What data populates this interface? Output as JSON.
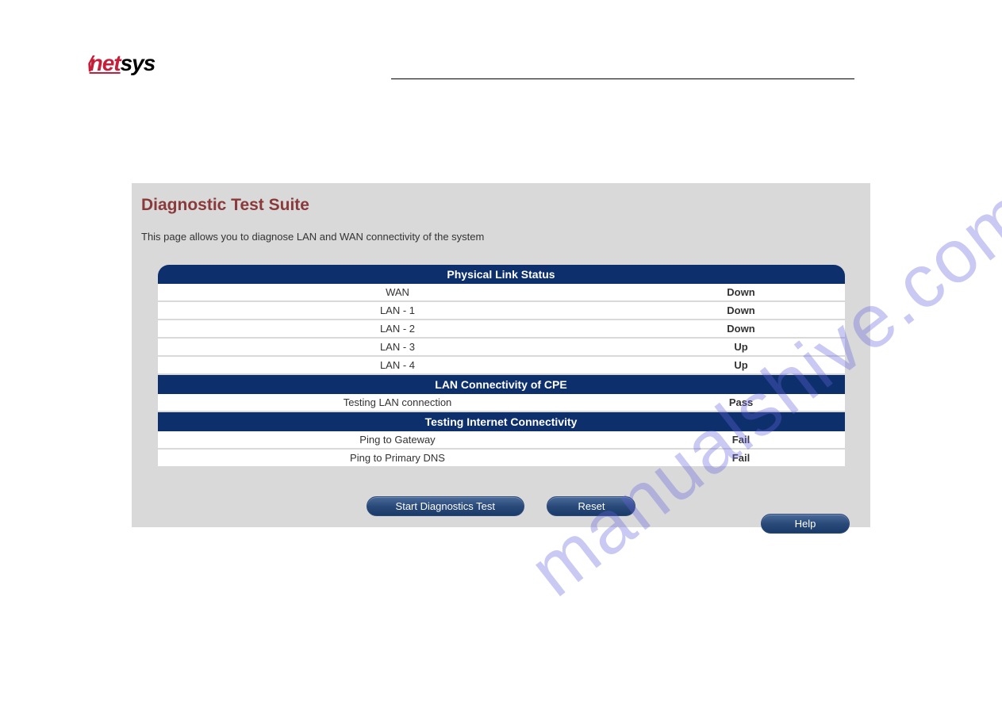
{
  "logo": {
    "prefix": "net",
    "suffix": "sys"
  },
  "watermark": "manualshive.com",
  "panel": {
    "title": "Diagnostic Test Suite",
    "description": "This page allows you to diagnose LAN and WAN connectivity of the system"
  },
  "sections": {
    "physical": {
      "header": "Physical Link Status",
      "rows": [
        {
          "label": "WAN",
          "status": "Down",
          "cls": "status-down"
        },
        {
          "label": "LAN - 1",
          "status": "Down",
          "cls": "status-down"
        },
        {
          "label": "LAN - 2",
          "status": "Down",
          "cls": "status-down"
        },
        {
          "label": "LAN - 3",
          "status": "Up",
          "cls": "status-up"
        },
        {
          "label": "LAN - 4",
          "status": "Up",
          "cls": "status-up"
        }
      ]
    },
    "lan": {
      "header": "LAN Connectivity of CPE",
      "rows": [
        {
          "label": "Testing LAN connection",
          "status": "Pass",
          "cls": "status-pass"
        }
      ]
    },
    "internet": {
      "header": "Testing Internet Connectivity",
      "rows": [
        {
          "label": "Ping to Gateway",
          "status": "Fail",
          "cls": "status-fail"
        },
        {
          "label": "Ping to Primary DNS",
          "status": "Fail",
          "cls": "status-fail"
        }
      ]
    }
  },
  "buttons": {
    "start": "Start Diagnostics Test",
    "reset": "Reset",
    "help": "Help"
  }
}
